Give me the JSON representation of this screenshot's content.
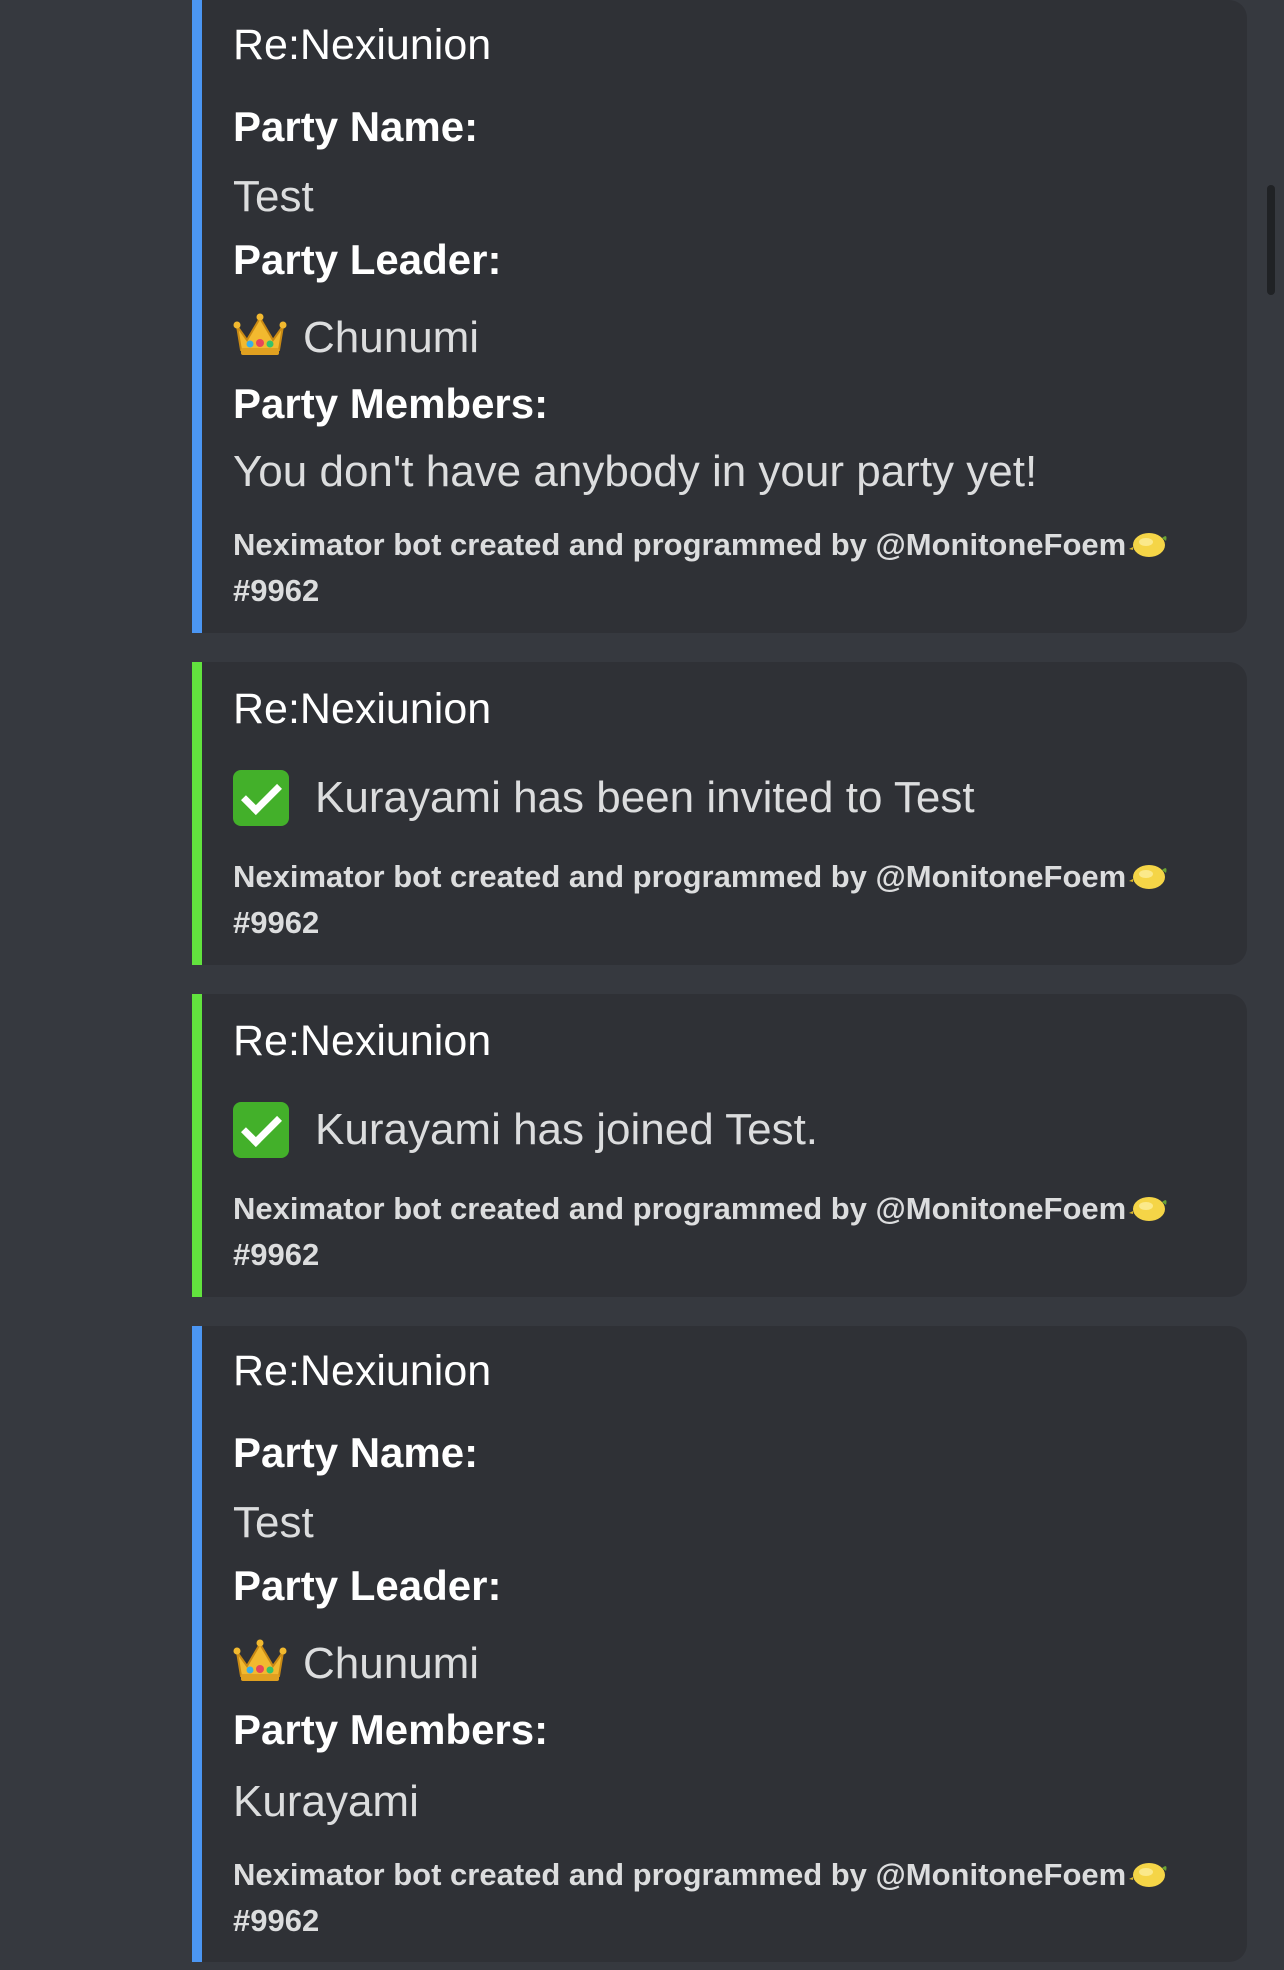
{
  "colors": {
    "background": "#36393f",
    "embed_background": "#2f3136",
    "blue_accent": "#4b96f3",
    "green_accent": "#62e33e"
  },
  "embeds": [
    {
      "title": "Re:Nexiunion",
      "fields": [
        {
          "name": "Party Name:",
          "value": "Test"
        },
        {
          "name": "Party Leader:",
          "value": "Chunumi",
          "icon": "crown-icon"
        },
        {
          "name": "Party Members:",
          "value": "You don't have anybody in your party yet!"
        }
      ],
      "footer": "Neximator bot created and programmed by @MonitoneFoem",
      "footer_tag": "#9962",
      "accent": "blue"
    },
    {
      "title": "Re:Nexiunion",
      "description": "Kurayami has been invited to Test",
      "description_icon": "check-mark-icon",
      "footer": "Neximator bot created and programmed by @MonitoneFoem",
      "footer_tag": "#9962",
      "accent": "green"
    },
    {
      "title": "Re:Nexiunion",
      "description": "Kurayami has joined Test.",
      "description_icon": "check-mark-icon",
      "footer": "Neximator bot created and programmed by @MonitoneFoem",
      "footer_tag": "#9962",
      "accent": "green"
    },
    {
      "title": "Re:Nexiunion",
      "fields": [
        {
          "name": "Party Name:",
          "value": "Test"
        },
        {
          "name": "Party Leader:",
          "value": "Chunumi",
          "icon": "crown-icon"
        },
        {
          "name": "Party Members:",
          "value": "Kurayami"
        }
      ],
      "footer": "Neximator bot created and programmed by @MonitoneFoem",
      "footer_tag": "#9962",
      "accent": "blue"
    }
  ]
}
